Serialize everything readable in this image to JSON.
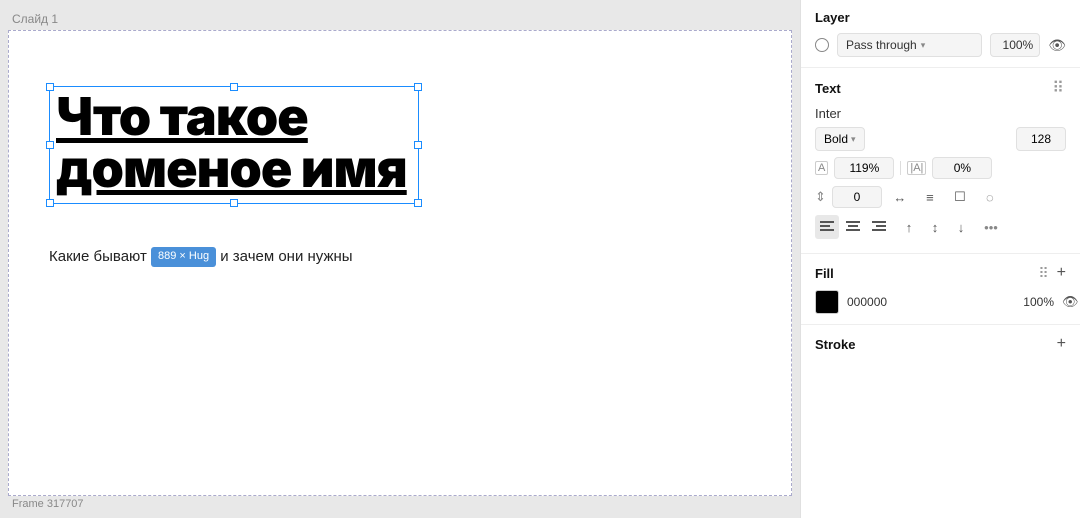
{
  "canvas": {
    "slide_label": "Слайд 1",
    "frame_label": "Frame 317707",
    "heading": "Что такое доменое имя",
    "subtext_part1": "Какие бывают ",
    "subtext_part2": " и зачем они нужны",
    "size_badge": "889 × Hug"
  },
  "panel": {
    "layer_section": {
      "title": "Layer",
      "blend_mode": "Pass through",
      "opacity": "100%"
    },
    "text_section": {
      "title": "Text",
      "font_name": "Inter",
      "font_style": "Bold",
      "font_size": "128",
      "line_height": "119%",
      "letter_spacing_label": "| A |",
      "letter_spacing": "0%",
      "paragraph_spacing": "0",
      "text_align_left": "≡",
      "text_align_center": "≡",
      "text_align_right": "≡",
      "valign_top": "↑",
      "valign_mid": "↕",
      "valign_bot": "↓"
    },
    "fill_section": {
      "title": "Fill",
      "color_hex": "000000",
      "opacity": "100%"
    },
    "stroke_section": {
      "title": "Stroke"
    }
  }
}
